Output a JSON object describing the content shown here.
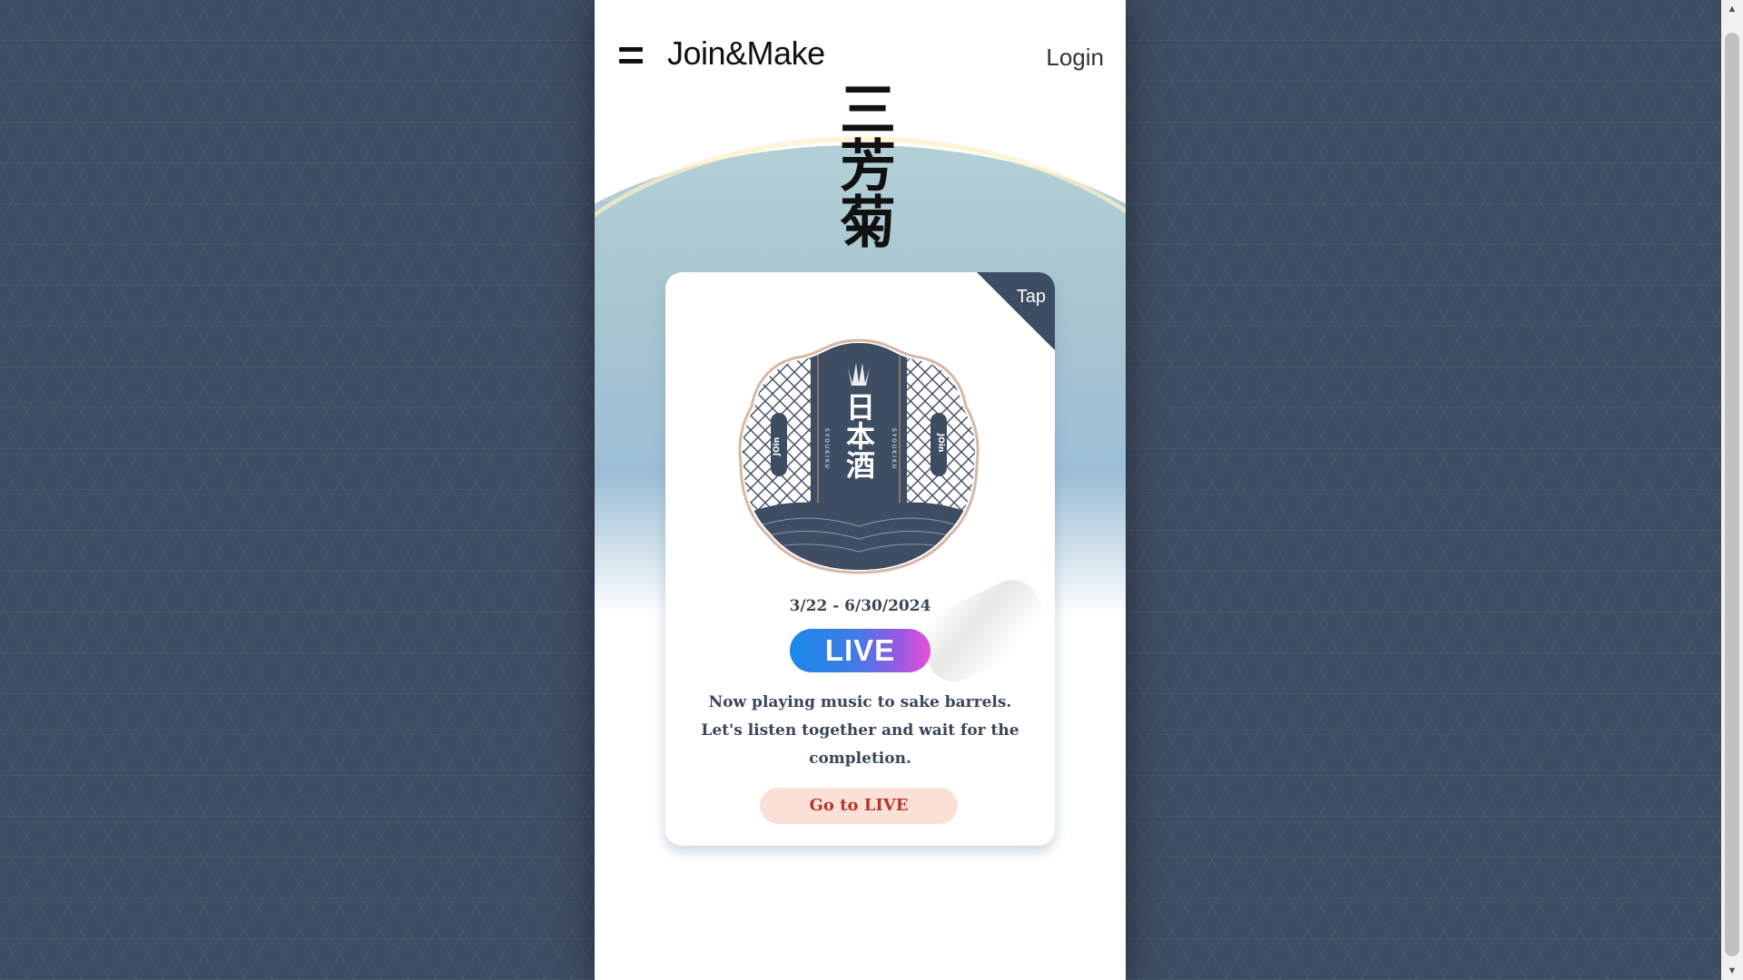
{
  "header": {
    "logo_text": "Join&Make",
    "login_label": "Login"
  },
  "hero": {
    "calligraphy_text": "三芳菊"
  },
  "card": {
    "corner_label": "Tap",
    "badge": {
      "center_text": "日本酒",
      "side_text_left": "SYOUKIKU",
      "side_text_right": "SYOUKIKU",
      "tag_left": "JOin",
      "tag_right": "JOin"
    },
    "dates": "3/22 - 6/30/2024",
    "live_label": "LIVE",
    "message_line1": "Now playing music to sake barrels.",
    "message_line2": "Let's listen together and wait for the",
    "message_line3": "completion.",
    "cta_label": "Go to LIVE"
  },
  "colors": {
    "page_background": "#3f4d62",
    "corner_tab": "#3f4d62",
    "cta_background": "#fbe0d8",
    "cta_text": "#b5362a",
    "live_gradient_start": "#1a89e8",
    "live_gradient_end": "#ea4fd8"
  }
}
